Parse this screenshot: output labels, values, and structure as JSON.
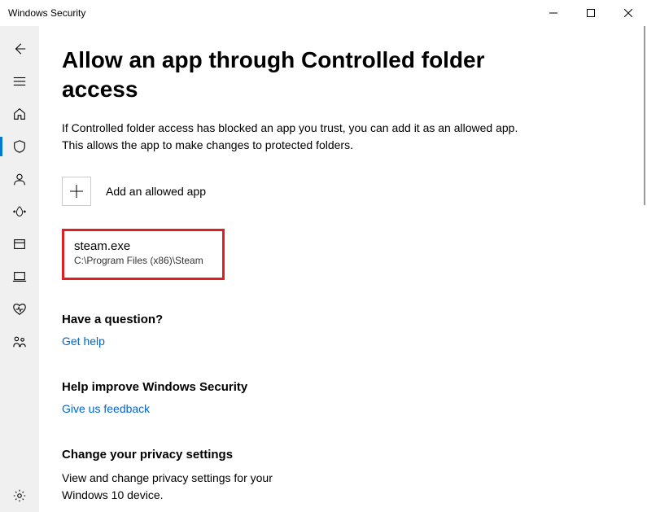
{
  "window": {
    "title": "Windows Security"
  },
  "page": {
    "title": "Allow an app through Controlled folder access",
    "description": "If Controlled folder access has blocked an app you trust, you can add it as an allowed app. This allows the app to make changes to protected folders."
  },
  "add_button": {
    "label": "Add an allowed app"
  },
  "allowed_apps": [
    {
      "name": "steam.exe",
      "path": "C:\\Program Files (x86)\\Steam"
    }
  ],
  "sections": {
    "question": {
      "title": "Have a question?",
      "link": "Get help"
    },
    "improve": {
      "title": "Help improve Windows Security",
      "link": "Give us feedback"
    },
    "privacy": {
      "title": "Change your privacy settings",
      "text": "View and change privacy settings for your Windows 10 device."
    }
  }
}
